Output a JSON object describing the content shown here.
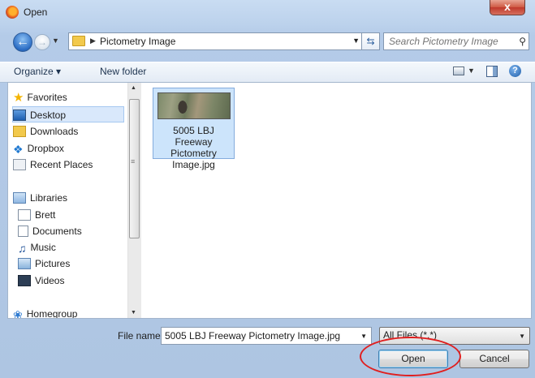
{
  "window": {
    "title": "Open",
    "close_label": "x"
  },
  "nav_bar": {
    "breadcrumb": "Pictometry Image",
    "search_placeholder": "Search Pictometry Image"
  },
  "toolbar": {
    "organize_label": "Organize ▾",
    "new_folder_label": "New folder"
  },
  "sidebar": {
    "favorites_label": "Favorites",
    "favorites": [
      {
        "label": "Desktop",
        "icon": "desktop-icon",
        "selected": true
      },
      {
        "label": "Downloads",
        "icon": "downloads-folder-icon"
      },
      {
        "label": "Dropbox",
        "icon": "dropbox-icon"
      },
      {
        "label": "Recent Places",
        "icon": "recent-places-icon"
      }
    ],
    "libraries_label": "Libraries",
    "libraries": [
      {
        "label": "Brett",
        "icon": "user-library-icon"
      },
      {
        "label": "Documents",
        "icon": "documents-icon"
      },
      {
        "label": "Music",
        "icon": "music-icon"
      },
      {
        "label": "Pictures",
        "icon": "pictures-icon"
      },
      {
        "label": "Videos",
        "icon": "videos-icon"
      }
    ],
    "homegroup_label": "Homegroup"
  },
  "files": [
    {
      "name": "5005 LBJ Freeway Pictometry Image.jpg",
      "selected": true
    }
  ],
  "file_name_row": {
    "label": "File name:",
    "value": "5005 LBJ Freeway Pictometry Image.jpg"
  },
  "file_type": {
    "selected": "All Files (*.*)"
  },
  "buttons": {
    "open": "Open",
    "cancel": "Cancel"
  },
  "colors": {
    "selection": "#cce4fb",
    "callout": "#e01f1f",
    "frame": "#b4cbe8"
  }
}
